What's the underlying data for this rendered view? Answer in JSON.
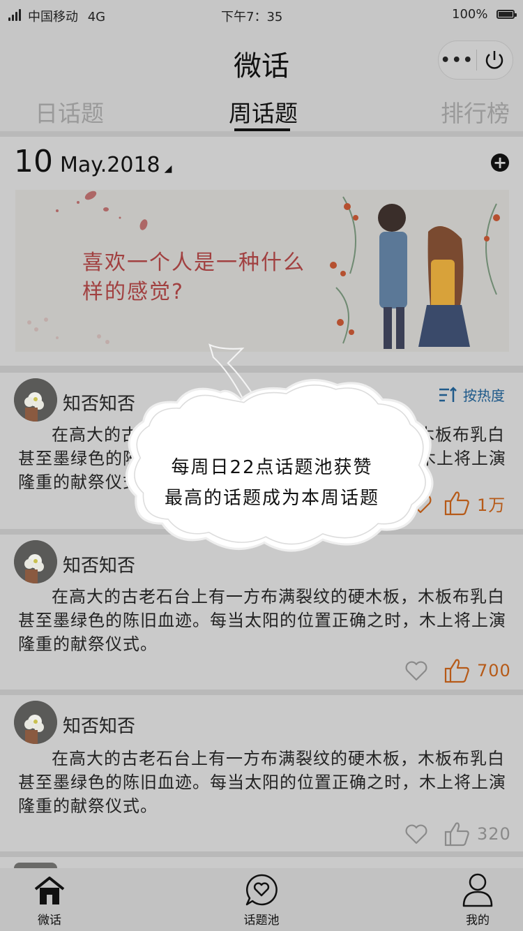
{
  "status_bar": {
    "carrier": "中国移动",
    "network": "4G",
    "time": "下午7：35",
    "battery": "100%"
  },
  "nav": {
    "title": "微话"
  },
  "tabs": [
    {
      "label": "日话题",
      "active": false
    },
    {
      "label": "周话题",
      "active": true
    },
    {
      "label": "排行榜",
      "active": false
    }
  ],
  "date_header": {
    "day": "10",
    "month_year": "May.2018"
  },
  "banner": {
    "text": "喜欢一个人是一种什么样的感觉?"
  },
  "sort": {
    "label": "按热度"
  },
  "posts": [
    {
      "author": "知否知否",
      "text": "在高大的古老石台上有一方布满裂纹的硬木板，木板布乳白甚至墨绿色的陈旧血迹。每当太阳的位置正确之时，木上将上演隆重的献祭仪式。",
      "likes": "1万"
    },
    {
      "author": "知否知否",
      "text": "在高大的古老石台上有一方布满裂纹的硬木板，木板布乳白甚至墨绿色的陈旧血迹。每当太阳的位置正确之时，木上将上演隆重的献祭仪式。",
      "likes": "700"
    },
    {
      "author": "知否知否",
      "text": "在高大的古老石台上有一方布满裂纹的硬木板，木板布乳白甚至墨绿色的陈旧血迹。每当太阳的位置正确之时，木上将上演隆重的献祭仪式。",
      "likes": "320"
    }
  ],
  "tooltip": {
    "line1": "每周日22点话题池获赞",
    "line2": "最高的话题成为本周话题"
  },
  "tabbar": [
    {
      "label": "微话",
      "icon": "home-icon"
    },
    {
      "label": "话题池",
      "icon": "heart-bubble-icon"
    },
    {
      "label": "我的",
      "icon": "person-icon"
    }
  ],
  "colors": {
    "accent_orange": "#b65a18",
    "sort_blue": "#1f5a8a",
    "banner_text": "#a14040"
  }
}
